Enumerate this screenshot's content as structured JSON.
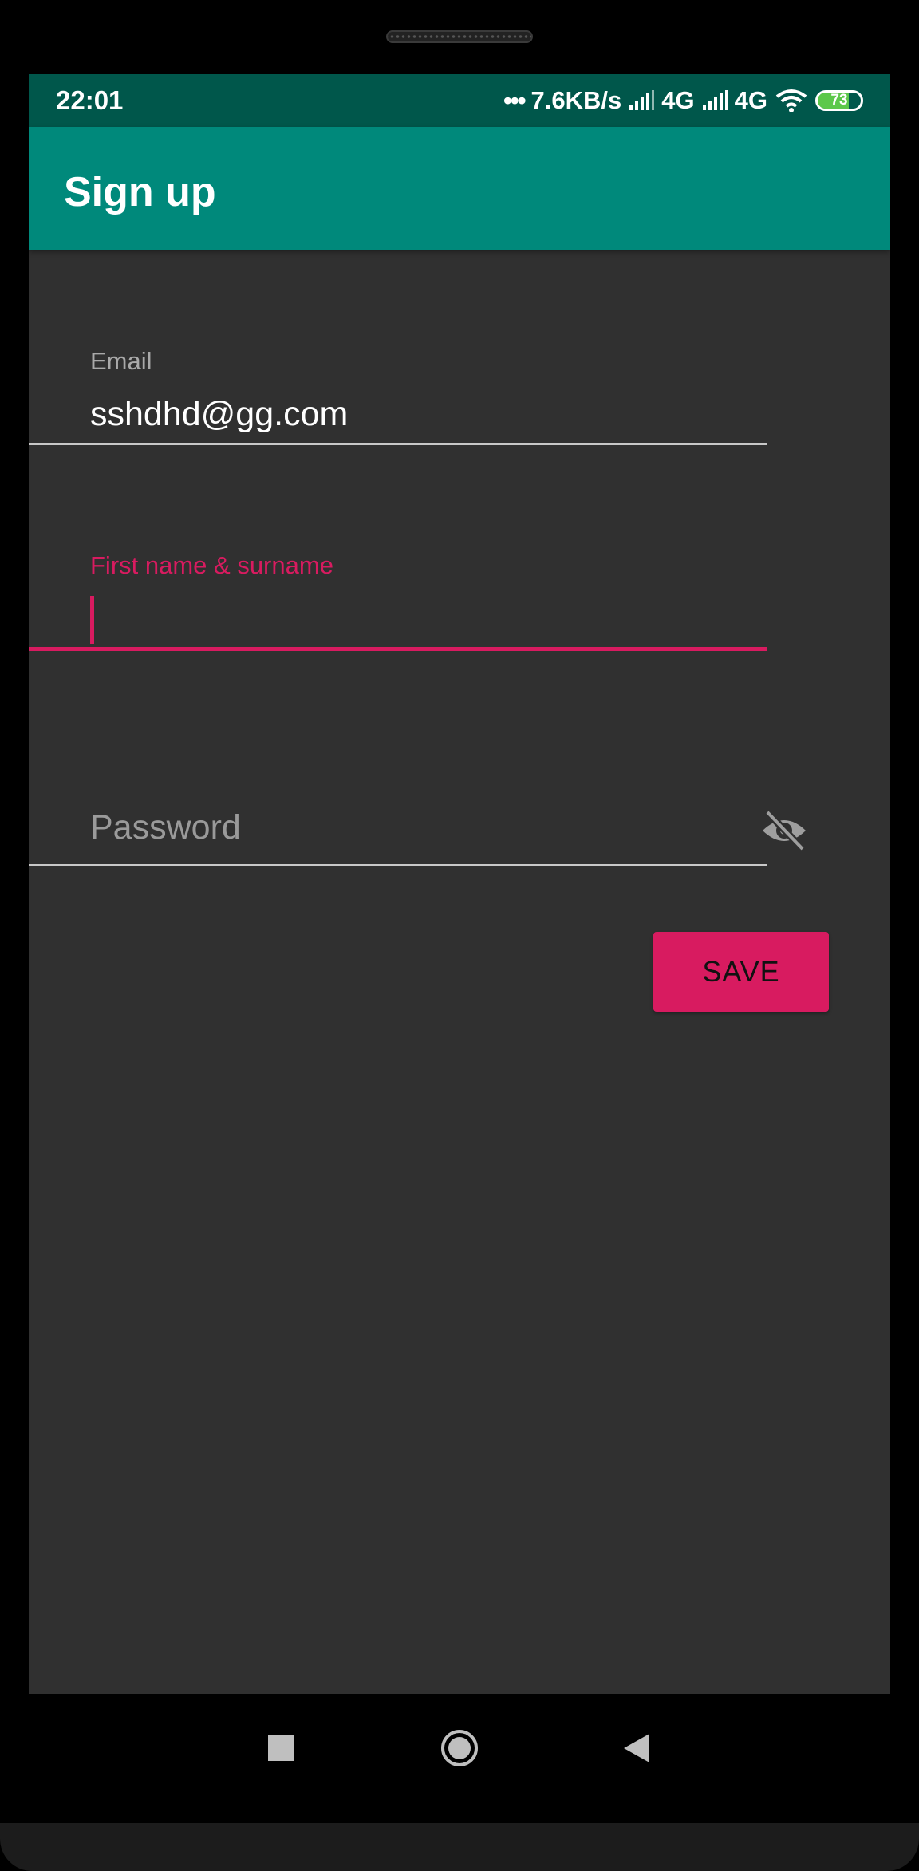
{
  "status_bar": {
    "time": "22:01",
    "dots": "•••",
    "network_speed": "7.6KB/s",
    "network_1": "4G",
    "network_2": "4G",
    "battery_level": "73",
    "battery_color": "#5cc84a"
  },
  "app_bar": {
    "title": "Sign up",
    "color": "#00897b"
  },
  "form": {
    "email": {
      "label": "Email",
      "value": "sshdhd@gg.com"
    },
    "name": {
      "label": "First name & surname",
      "value": ""
    },
    "password": {
      "placeholder": "Password",
      "toggle_icon": "visibility-off-icon"
    },
    "save_label": "SAVE",
    "accent_color": "#d81b60"
  },
  "navigation": {
    "icons": [
      "recents-square-icon",
      "home-circle-icon",
      "back-triangle-icon"
    ]
  }
}
